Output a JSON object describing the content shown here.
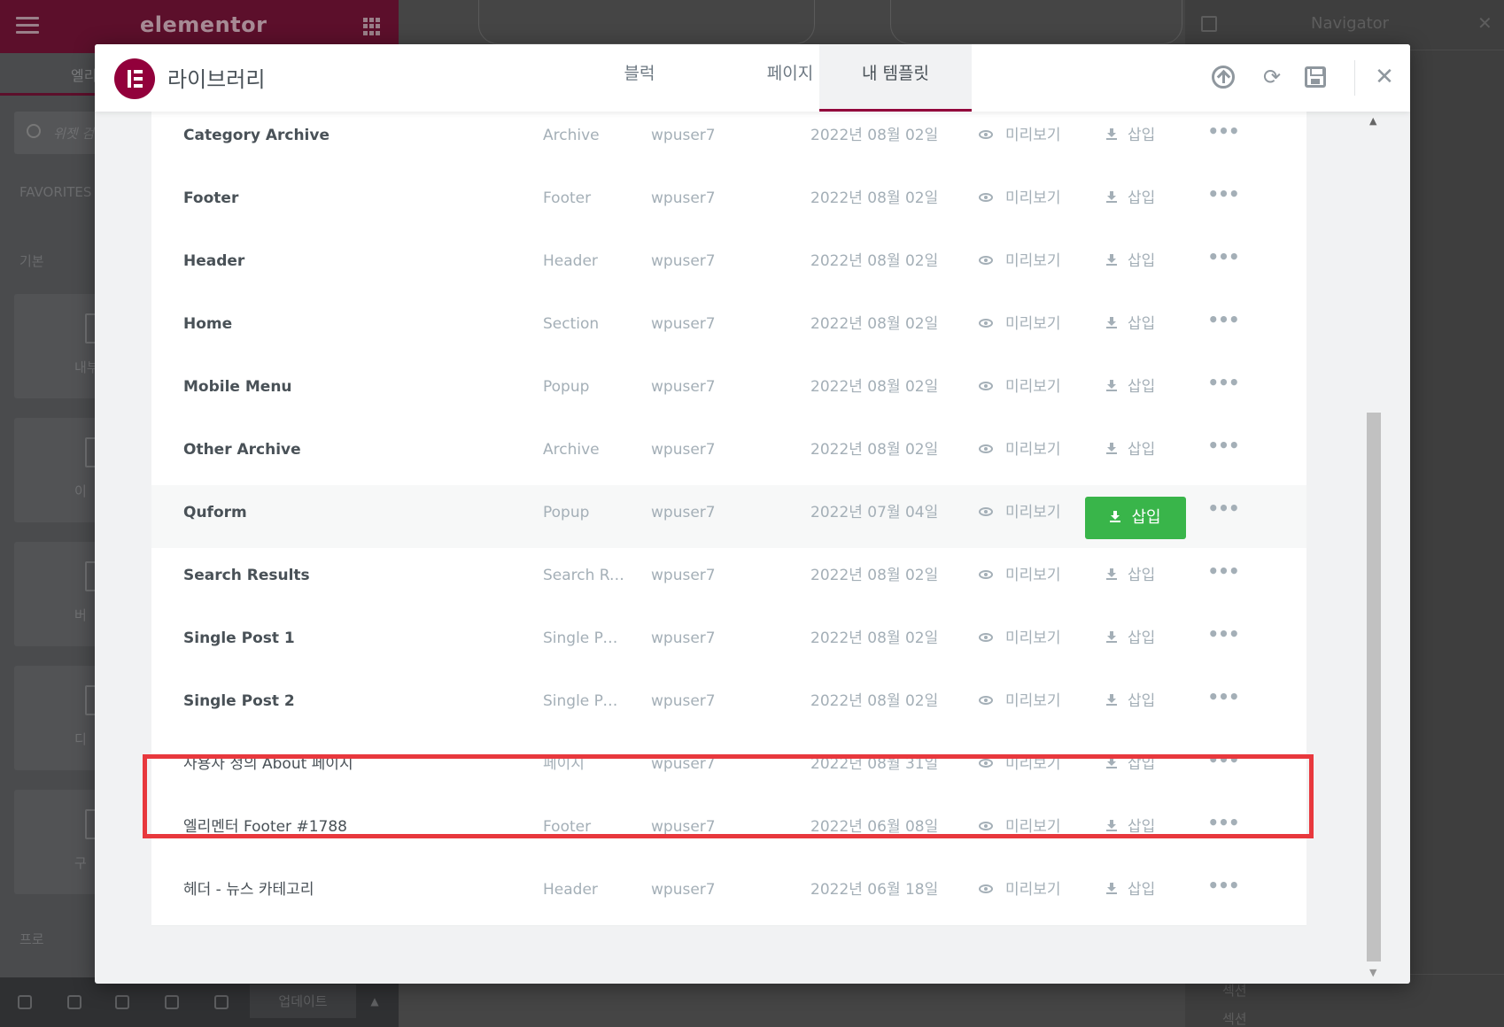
{
  "background": {
    "brand": "elementor",
    "panel_tab": "엘리",
    "search_placeholder": "위젯 검",
    "section_favorites": "FAVORITES",
    "section_basic": "기본",
    "section_pro": "프로",
    "widgets": [
      "내부",
      "이",
      "버",
      "디",
      "구"
    ],
    "update_button": "업데이트",
    "navigator_title": "Navigator",
    "navigator_items": [
      "섹션",
      "섹션"
    ]
  },
  "modal": {
    "title": "라이브러리",
    "tabs": [
      {
        "label": "블럭",
        "active": false
      },
      {
        "label": "페이지",
        "active": false
      },
      {
        "label": "내 템플릿",
        "active": true
      }
    ],
    "icons": [
      "upload-icon",
      "sync-icon",
      "save-icon",
      "close-icon"
    ]
  },
  "templates": [
    {
      "name": "Category Archive",
      "type": "Archive",
      "author": "wpuser7",
      "date": "2022년 08월 02일",
      "preview": "미리보기",
      "insert": "삽입"
    },
    {
      "name": "Footer",
      "type": "Footer",
      "author": "wpuser7",
      "date": "2022년 08월 02일",
      "preview": "미리보기",
      "insert": "삽입"
    },
    {
      "name": "Header",
      "type": "Header",
      "author": "wpuser7",
      "date": "2022년 08월 02일",
      "preview": "미리보기",
      "insert": "삽입"
    },
    {
      "name": "Home",
      "type": "Section",
      "author": "wpuser7",
      "date": "2022년 08월 02일",
      "preview": "미리보기",
      "insert": "삽입"
    },
    {
      "name": "Mobile Menu",
      "type": "Popup",
      "author": "wpuser7",
      "date": "2022년 08월 02일",
      "preview": "미리보기",
      "insert": "삽입"
    },
    {
      "name": "Other Archive",
      "type": "Archive",
      "author": "wpuser7",
      "date": "2022년 08월 02일",
      "preview": "미리보기",
      "insert": "삽입"
    },
    {
      "name": "Quform",
      "type": "Popup",
      "author": "wpuser7",
      "date": "2022년 07월 04일",
      "preview": "미리보기",
      "insert": "삽입"
    },
    {
      "name": "Search Results",
      "type": "Search Re...",
      "author": "wpuser7",
      "date": "2022년 08월 02일",
      "preview": "미리보기",
      "insert": "삽입"
    },
    {
      "name": "Single Post 1",
      "type": "Single Post",
      "author": "wpuser7",
      "date": "2022년 08월 02일",
      "preview": "미리보기",
      "insert": "삽입"
    },
    {
      "name": "Single Post 2",
      "type": "Single Post",
      "author": "wpuser7",
      "date": "2022년 08월 02일",
      "preview": "미리보기",
      "insert": "삽입"
    },
    {
      "name": "사용자 정의 About 페이지",
      "type": "페이지",
      "author": "wpuser7",
      "date": "2022년 08월 31일",
      "preview": "미리보기",
      "insert": "삽입"
    },
    {
      "name": "엘리멘터 Footer #1788",
      "type": "Footer",
      "author": "wpuser7",
      "date": "2022년 06월 08일",
      "preview": "미리보기",
      "insert": "삽입"
    },
    {
      "name": "헤더 - 뉴스 카테고리",
      "type": "Header",
      "author": "wpuser7",
      "date": "2022년 06월 18일",
      "preview": "미리보기",
      "insert": "삽입"
    }
  ],
  "hovered_row": 6,
  "highlighted_row": 10,
  "colors": {
    "brand": "#92003b",
    "insert_button": "#39b54a",
    "highlight": "#e8383d"
  }
}
